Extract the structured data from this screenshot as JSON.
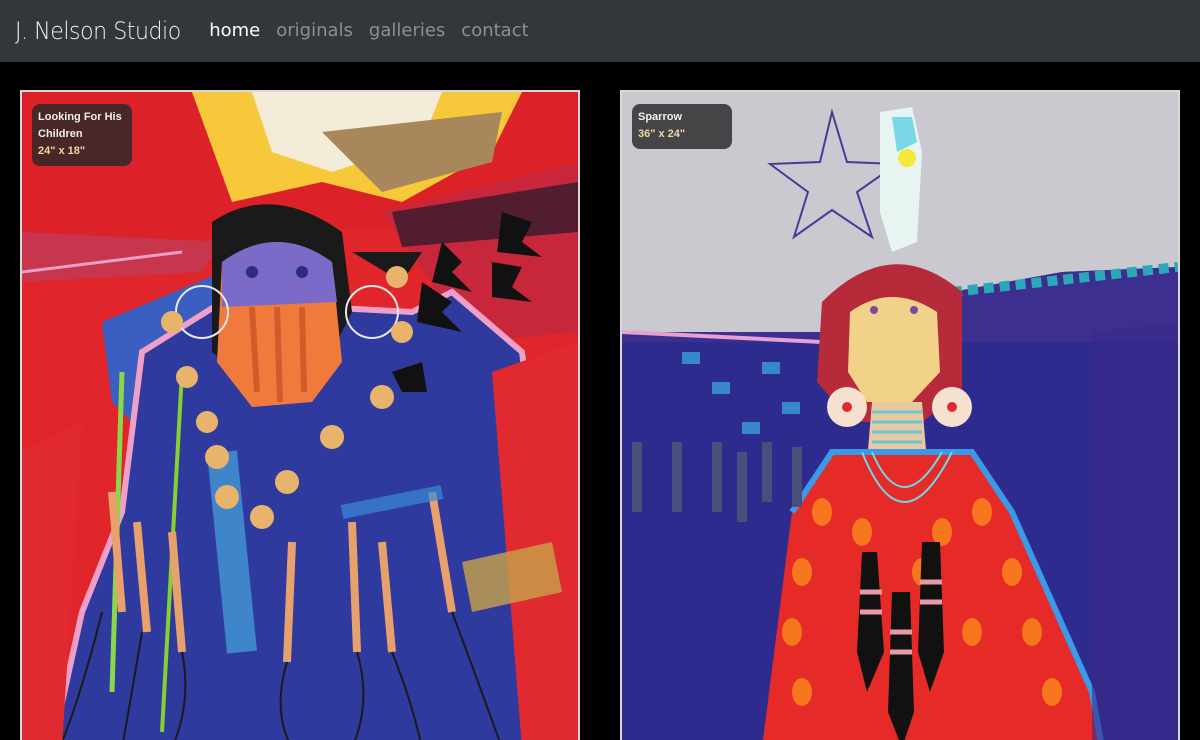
{
  "header": {
    "brand": "J. Nelson Studio",
    "nav": [
      {
        "label": "home",
        "active": true
      },
      {
        "label": "originals",
        "active": false
      },
      {
        "label": "galleries",
        "active": false
      },
      {
        "label": "contact",
        "active": false
      }
    ]
  },
  "gallery": {
    "items": [
      {
        "title": "Looking For His Children",
        "size": "24\" x 18\""
      },
      {
        "title": "Sparrow",
        "size": "36\" x 24\""
      }
    ]
  },
  "colors": {
    "header_bg": "#33363b",
    "page_bg": "#000000",
    "nav_active": "#ffffff",
    "nav_inactive": "#8c8f94"
  }
}
